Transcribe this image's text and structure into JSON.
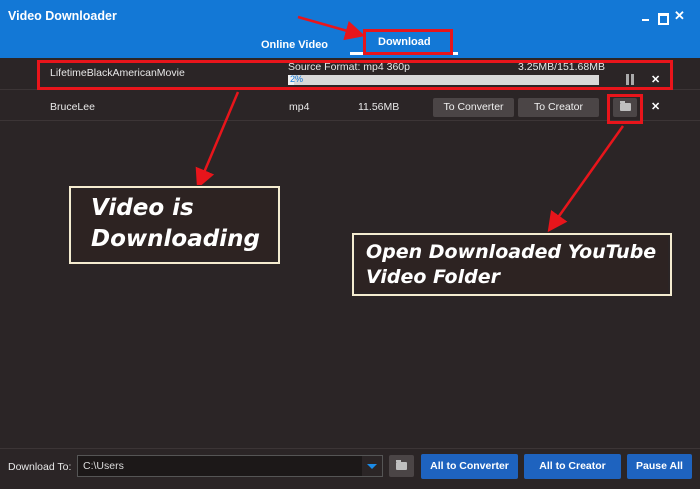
{
  "window": {
    "title": "Video Downloader",
    "controls": [
      "minimize-icon",
      "maximize-icon",
      "close-icon"
    ]
  },
  "tabs": {
    "online_video": "Online Video",
    "download": "Download",
    "active": "download"
  },
  "downloads": [
    {
      "name": "LifetimeBlackAmericanMovie",
      "status": "Source Format: mp4 360p",
      "size": "3.25MB/151.68MB",
      "progress_text": "2%",
      "progress": 0.02,
      "pause_icon": "pause-icon",
      "remove_icon": "close-icon"
    },
    {
      "name": "BruceLee",
      "format": "mp4",
      "size": "11.56MB",
      "to_converter": "To Converter",
      "to_creator": "To Creator",
      "folder_icon": "folder-icon",
      "remove_icon": "close-icon"
    }
  ],
  "annotations": {
    "downloading_callout": [
      "Video is",
      "Downloading"
    ],
    "folder_callout": [
      "Open Downloaded YouTube",
      "Video Folder"
    ],
    "highlight_color": "#e8151b"
  },
  "bottom": {
    "download_to_label": "Download To:",
    "path": "C:\\Users",
    "all_to_converter": "All to Converter",
    "all_to_creator": "All to Creator",
    "pause_all": "Pause All"
  },
  "colors": {
    "titlebar": "#1378d6",
    "background": "#2b2526",
    "button_blue": "#1e63bf"
  }
}
